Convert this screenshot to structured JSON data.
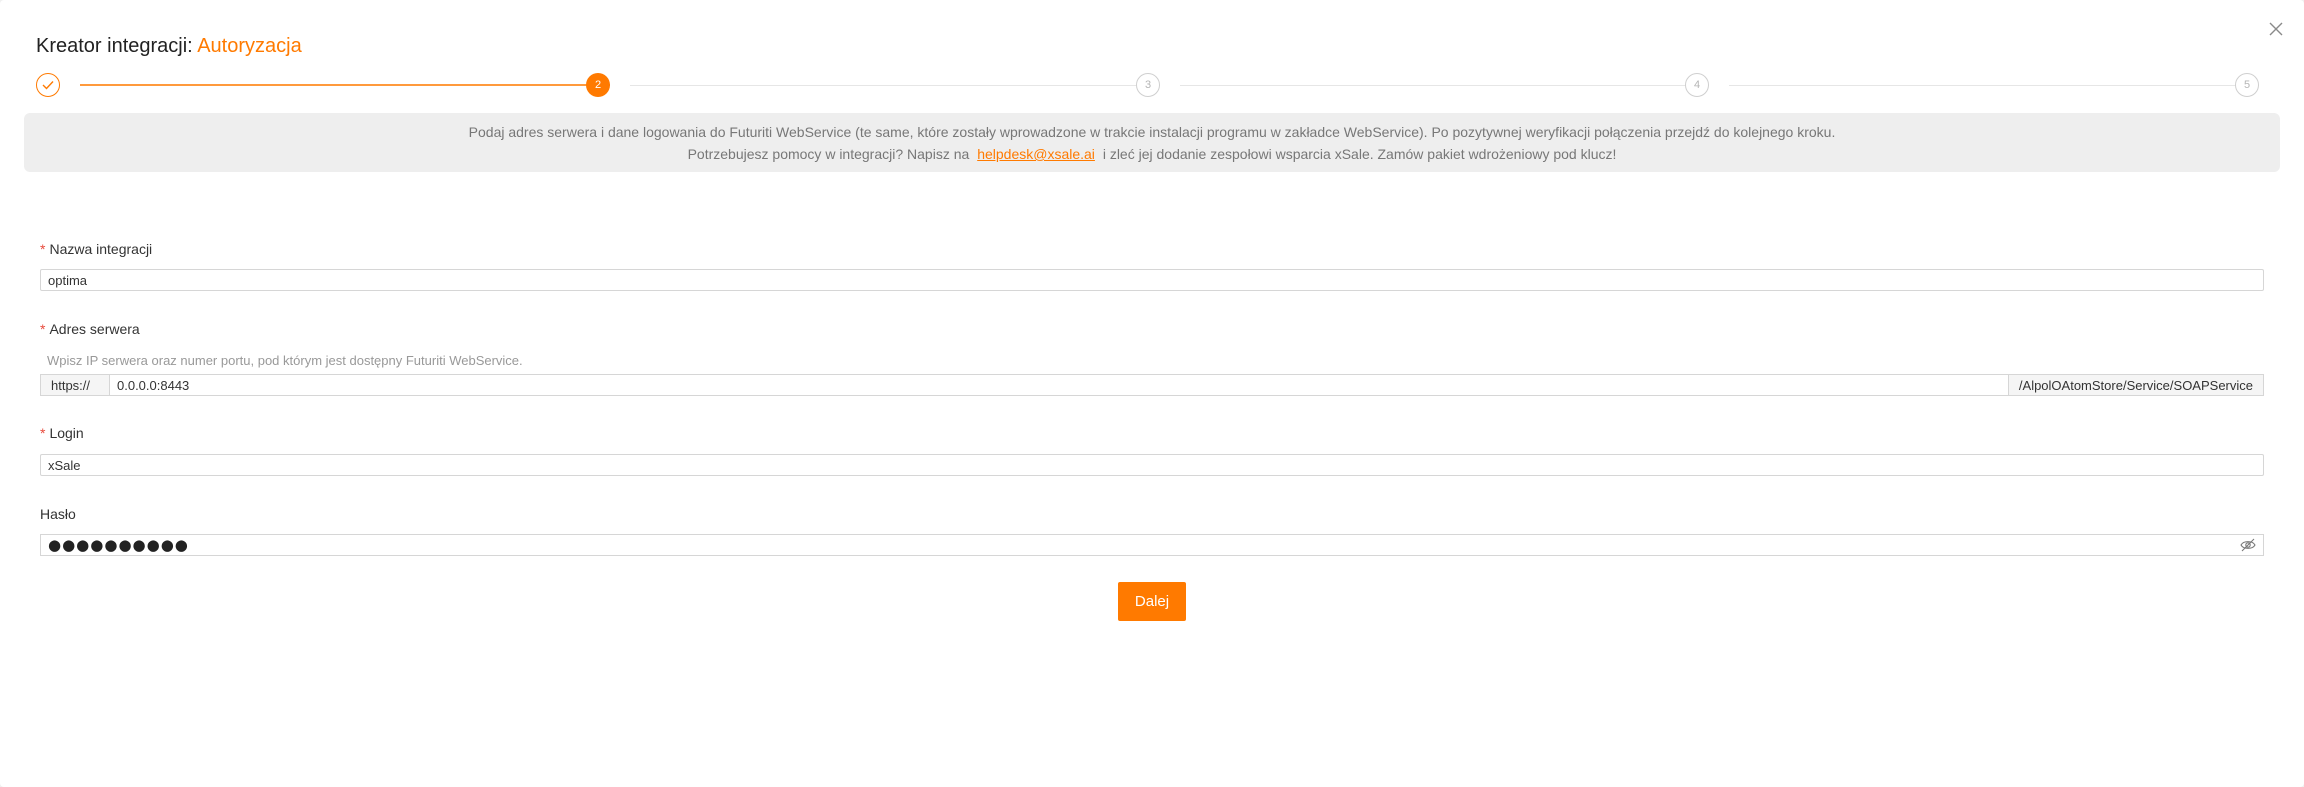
{
  "dialog": {
    "title_prefix": "Kreator integracji:",
    "title_step": "Autoryzacja",
    "close_symbol": "×"
  },
  "stepper": {
    "steps": [
      {
        "label": "",
        "state": "done",
        "icon": "check-icon"
      },
      {
        "label": "2",
        "state": "active"
      },
      {
        "label": "3",
        "state": "pending"
      },
      {
        "label": "4",
        "state": "pending"
      },
      {
        "label": "5",
        "state": "pending"
      }
    ]
  },
  "info": {
    "line1": "Podaj adres serwera i dane logowania do Futuriti WebService (te same, które zostały wprowadzone w trakcie instalacji programu w zakładce WebService). Po pozytywnej weryfikacji połączenia przejdź do kolejnego kroku.",
    "line2_before": "Potrzebujesz pomocy w integracji? Napisz na",
    "email": "helpdesk@xsale.ai",
    "line2_after": "i zleć jej dodanie zespołowi wsparcia xSale. Zamów pakiet wdrożeniowy pod klucz!"
  },
  "form": {
    "required_mark": "*",
    "integration_name": {
      "label": "Nazwa integracji",
      "value": "optima"
    },
    "server": {
      "label": "Adres serwera",
      "hint": "Wpisz IP serwera oraz numer portu, pod którym jest dostępny Futuriti WebService.",
      "prefix": "https://",
      "value": "0.0.0.0:8443",
      "suffix": "/AlpolOAtomStore/Service/SOAPService"
    },
    "login": {
      "label": "Login",
      "value": "xSale"
    },
    "password": {
      "label": "Hasło",
      "masked": "●●●●●●●●●●"
    }
  },
  "actions": {
    "next_label": "Dalej"
  },
  "colors": {
    "accent": "#ff7a00",
    "required": "#e84a3c",
    "info_bg": "#eeeeee"
  }
}
